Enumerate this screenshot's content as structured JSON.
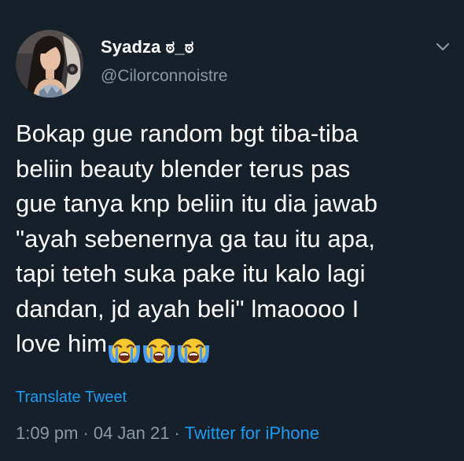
{
  "tweet": {
    "author": {
      "display_name": "Syadza ಠ_ಠ",
      "handle": "@Cilorconnoistre"
    },
    "text_lines": [
      "Bokap gue random bgt tiba-tiba",
      "beliin beauty blender terus pas",
      "gue tanya knp beliin itu dia jawab",
      "\"ayah sebenernya ga tau itu apa,",
      "tapi teteh suka pake itu kalo lagi",
      "dandan, jd ayah beli\" lmaoooo I",
      "love him"
    ],
    "emoji": [
      "loudly-crying-face",
      "loudly-crying-face",
      "loudly-crying-face"
    ],
    "translate_label": "Translate Tweet",
    "time": "1:09 pm",
    "separator": "·",
    "date": "04 Jan 21",
    "source": "Twitter for iPhone"
  },
  "colors": {
    "background": "#15202b",
    "text_primary": "#ffffff",
    "text_secondary": "#8b98a5",
    "accent": "#1d9bf0"
  }
}
